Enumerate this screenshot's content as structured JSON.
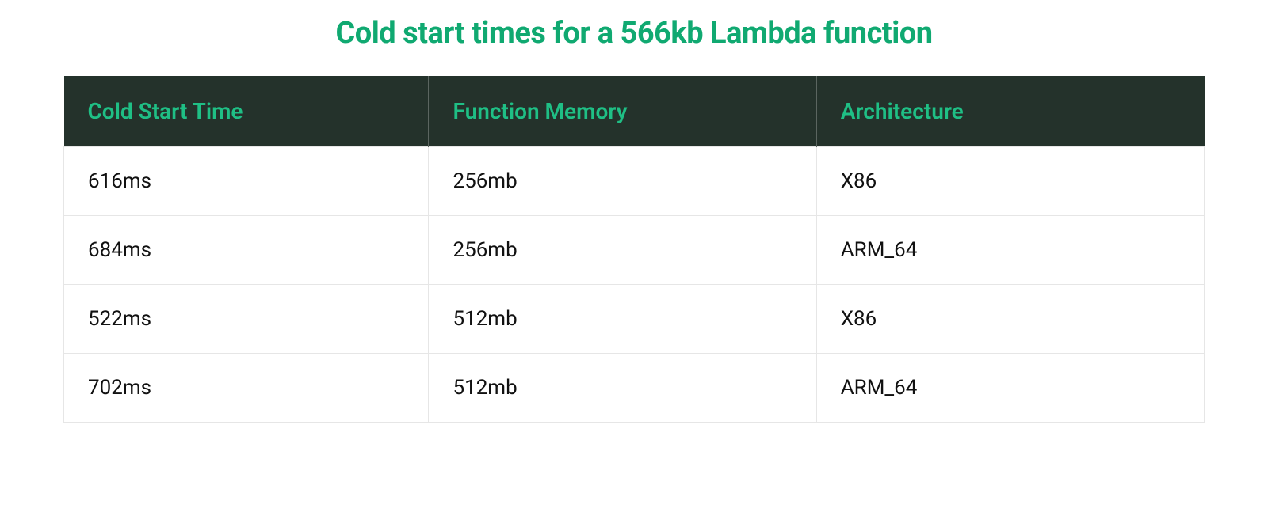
{
  "title": "Cold start times for a 566kb Lambda function",
  "colors": {
    "accent": "#10a971",
    "header_bg": "#24322b",
    "header_text": "#1fbf85",
    "body_text": "#111111",
    "border": "#e6e6e6"
  },
  "chart_data": {
    "type": "table",
    "title": "Cold start times for a 566kb Lambda function",
    "columns": [
      "Cold Start Time",
      "Function Memory",
      "Architecture"
    ],
    "rows": [
      {
        "cold_start_time": "616ms",
        "function_memory": "256mb",
        "architecture": "X86"
      },
      {
        "cold_start_time": "684ms",
        "function_memory": "256mb",
        "architecture": "ARM_64"
      },
      {
        "cold_start_time": "522ms",
        "function_memory": "512mb",
        "architecture": "X86"
      },
      {
        "cold_start_time": "702ms",
        "function_memory": "512mb",
        "architecture": "ARM_64"
      }
    ]
  }
}
